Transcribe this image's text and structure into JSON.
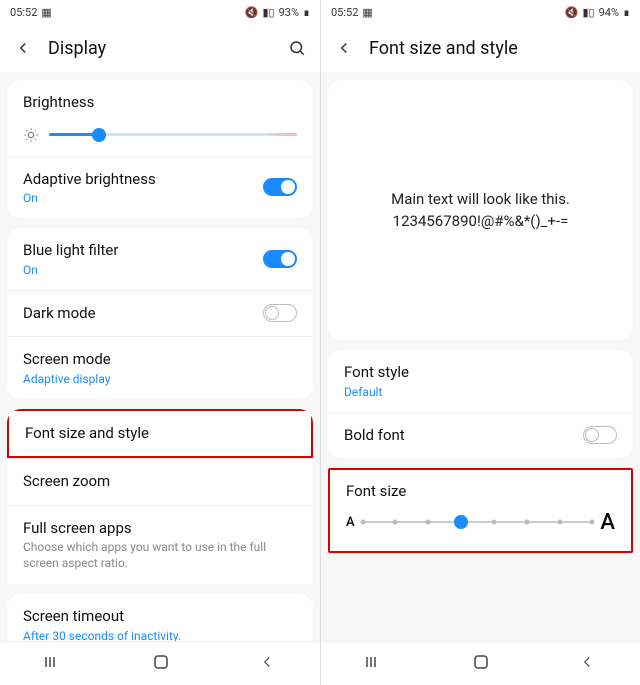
{
  "left": {
    "status": {
      "time": "05:52",
      "battery": "93%"
    },
    "header": {
      "title": "Display"
    },
    "brightness": {
      "label": "Brightness",
      "percent": 20
    },
    "adaptive": {
      "label": "Adaptive brightness",
      "status": "On",
      "on": true
    },
    "bluelight": {
      "label": "Blue light filter",
      "status": "On",
      "on": true
    },
    "darkmode": {
      "label": "Dark mode",
      "on": false
    },
    "screenmode": {
      "label": "Screen mode",
      "status": "Adaptive display"
    },
    "fontsize": {
      "label": "Font size and style"
    },
    "screenzoom": {
      "label": "Screen zoom"
    },
    "fullscreen": {
      "label": "Full screen apps",
      "desc": "Choose which apps you want to use in the full screen aspect ratio."
    },
    "timeout": {
      "label": "Screen timeout",
      "status": "After 30 seconds of inactivity."
    }
  },
  "right": {
    "status": {
      "time": "05:52",
      "battery": "94%"
    },
    "header": {
      "title": "Font size and style"
    },
    "preview": {
      "line1": "Main text will look like this.",
      "line2": "1234567890!@#%&*()_+-="
    },
    "fontstyle": {
      "label": "Font style",
      "status": "Default"
    },
    "boldfont": {
      "label": "Bold font",
      "on": false
    },
    "fontsize": {
      "label": "Font size",
      "small": "A",
      "large": "A",
      "steps": 8,
      "current": 3
    }
  }
}
